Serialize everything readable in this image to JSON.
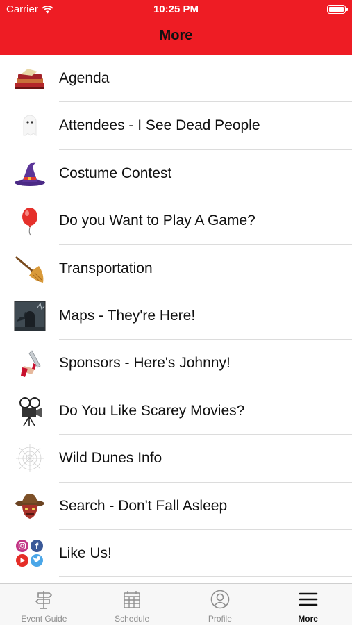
{
  "status_bar": {
    "carrier": "Carrier",
    "time": "10:25 PM"
  },
  "nav": {
    "title": "More"
  },
  "menu_items": [
    {
      "label": "Agenda",
      "icon": "books-icon"
    },
    {
      "label": "Attendees - I See Dead People",
      "icon": "ghost-icon"
    },
    {
      "label": "Costume Contest",
      "icon": "witch-hat-icon"
    },
    {
      "label": "Do you Want to Play A Game?",
      "icon": "balloon-icon"
    },
    {
      "label": "Transportation",
      "icon": "broom-icon"
    },
    {
      "label": "Maps - They're Here!",
      "icon": "tombstone-icon"
    },
    {
      "label": "Sponsors - Here's Johnny!",
      "icon": "knife-icon"
    },
    {
      "label": "Do You Like Scarey Movies?",
      "icon": "film-camera-icon"
    },
    {
      "label": "Wild Dunes Info",
      "icon": "spider-web-icon"
    },
    {
      "label": "Search - Don't Fall Asleep",
      "icon": "hat-face-icon"
    },
    {
      "label": "Like Us!",
      "icon": "social-media-icon"
    }
  ],
  "tabs": [
    {
      "label": "Event Guide",
      "icon": "signpost-icon",
      "active": false
    },
    {
      "label": "Schedule",
      "icon": "calendar-icon",
      "active": false
    },
    {
      "label": "Profile",
      "icon": "profile-icon",
      "active": false
    },
    {
      "label": "More",
      "icon": "menu-icon",
      "active": true
    }
  ],
  "colors": {
    "header": "#ee1c24",
    "tab_active": "#111111",
    "tab_inactive": "#8e8e8e"
  }
}
